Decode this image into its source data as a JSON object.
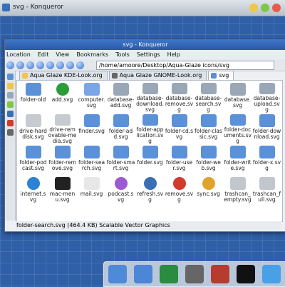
{
  "outer": {
    "title": "svg - Konqueror"
  },
  "window": {
    "title": "svg - Konqueror"
  },
  "menu": [
    "Location",
    "Edit",
    "View",
    "Bookmarks",
    "Tools",
    "Settings",
    "Help"
  ],
  "location": {
    "value": "/home/amoore/Desktop/Aqua-Glaze icons/svg"
  },
  "tabs": [
    {
      "label": "Aqua Glaze KDE-Look.org"
    },
    {
      "label": "Aqua Glaze GNOME-Look.org"
    },
    {
      "label": "svg"
    }
  ],
  "files": [
    {
      "name": "folder-old",
      "icon": "folder-icon"
    },
    {
      "name": "add.svg",
      "icon": "add-icon"
    },
    {
      "name": "computer.svg",
      "icon": "computer-icon"
    },
    {
      "name": "database-add.svg",
      "icon": "database-icon"
    },
    {
      "name": "database-download.svg",
      "icon": "database-icon"
    },
    {
      "name": "database-remove.svg",
      "icon": "database-icon"
    },
    {
      "name": "database-search.svg",
      "icon": "database-icon"
    },
    {
      "name": "database.svg",
      "icon": "database-icon"
    },
    {
      "name": "database-upload.svg",
      "icon": "database-icon"
    },
    {
      "name": "drive-harddisk.svg",
      "icon": "drive-icon"
    },
    {
      "name": "drive-removable-media.svg",
      "icon": "drive-icon"
    },
    {
      "name": "finder.svg",
      "icon": "finder-icon"
    },
    {
      "name": "folder-add.svg",
      "icon": "folder-icon"
    },
    {
      "name": "folder-application.svg",
      "icon": "folder-icon"
    },
    {
      "name": "folder-cd.svg",
      "icon": "folder-icon"
    },
    {
      "name": "folder-classic.svg",
      "icon": "folder-icon"
    },
    {
      "name": "folder-documents.svg",
      "icon": "folder-icon"
    },
    {
      "name": "folder-download.svg",
      "icon": "folder-icon"
    },
    {
      "name": "folder-podcast.svg",
      "icon": "folder-icon"
    },
    {
      "name": "folder-remove.svg",
      "icon": "folder-icon"
    },
    {
      "name": "folder-search.svg",
      "icon": "folder-icon"
    },
    {
      "name": "folder-smart.svg",
      "icon": "folder-icon"
    },
    {
      "name": "folder.svg",
      "icon": "folder-icon"
    },
    {
      "name": "folder-user.svg",
      "icon": "folder-icon"
    },
    {
      "name": "folder-web.svg",
      "icon": "folder-icon"
    },
    {
      "name": "folder-write.svg",
      "icon": "folder-icon"
    },
    {
      "name": "folder-x.svg",
      "icon": "folder-icon"
    },
    {
      "name": "internet.svg",
      "icon": "globe-icon"
    },
    {
      "name": "mac-menu.svg",
      "icon": "apple-icon"
    },
    {
      "name": "mail.svg",
      "icon": "mail-icon"
    },
    {
      "name": "podcast.svg",
      "icon": "podcast-icon"
    },
    {
      "name": "refresh.svg",
      "icon": "refresh-icon"
    },
    {
      "name": "remove.svg",
      "icon": "remove-icon"
    },
    {
      "name": "sync.svg",
      "icon": "sync-icon"
    },
    {
      "name": "trashcan_empty.svg",
      "icon": "trash-icon"
    },
    {
      "name": "trashcan_full.svg",
      "icon": "trash-icon"
    }
  ],
  "status": {
    "text": "folder-search.svg (464.4 KB)  Scalable Vector Graphics"
  },
  "dock": [
    {
      "name": "monitor-icon"
    },
    {
      "name": "finder-icon"
    },
    {
      "name": "globe-icon"
    },
    {
      "name": "mirror-icon"
    },
    {
      "name": "media-icon"
    },
    {
      "name": "terminal-icon"
    },
    {
      "name": "folder-icon"
    }
  ],
  "colors": {
    "accent": "#2f5fa7",
    "folder": "#5b91d8",
    "database": "#9aa7b7",
    "green": "#2a9c3a",
    "red": "#d23a2a"
  }
}
